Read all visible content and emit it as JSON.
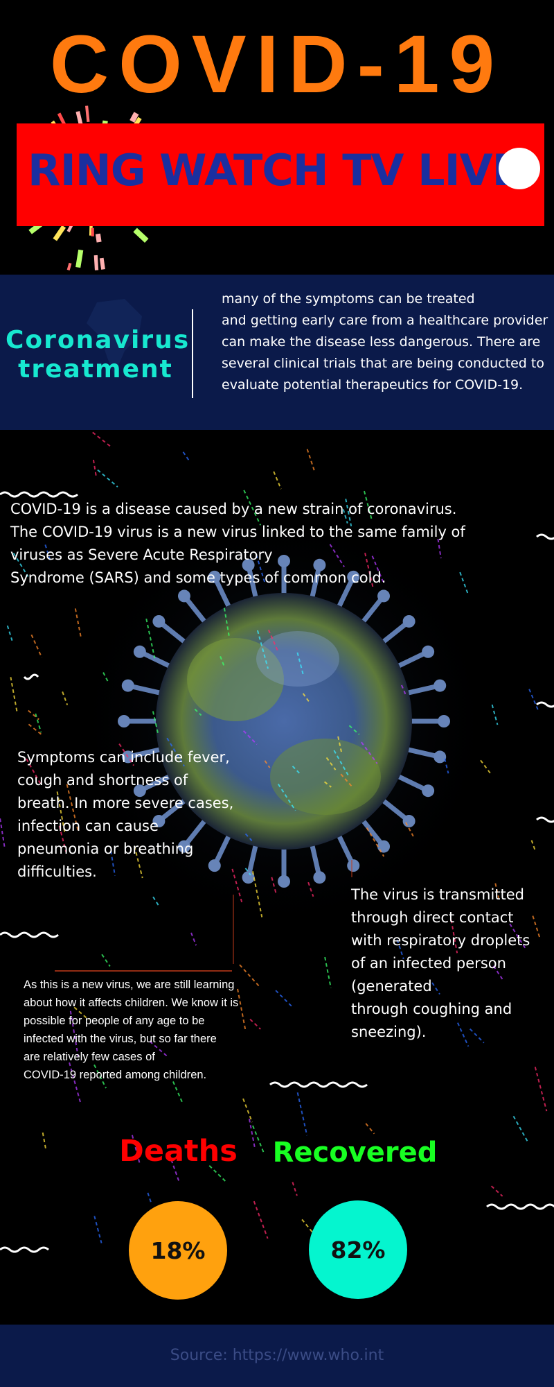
{
  "header": {
    "title": "COVID-19",
    "banner_text": "RING WATCH TV LIVE"
  },
  "treatment": {
    "title_line1": "Coronavirus",
    "title_line2": "treatment",
    "lines": [
      "many of the symptoms can be treated",
      "and getting early care from a healthcare provider",
      "can make the disease less dangerous. There are",
      "several clinical trials that are being conducted to",
      "evaluate potential therapeutics for COVID-19."
    ]
  },
  "intro": {
    "lines": [
      "COVID-19 is a disease caused by a new strain of coronavirus.",
      "The COVID-19 virus is a new virus linked to the same family of",
      "viruses as Severe Acute Respiratory",
      "Syndrome (SARS) and some types of common cold."
    ]
  },
  "symptoms": {
    "lines": [
      "Symptoms can include fever,",
      "cough and shortness of",
      "breath. In more severe cases,",
      "infection can cause",
      "pneumonia or breathing",
      "difficulties."
    ]
  },
  "transmission": {
    "lines": [
      "The virus is transmitted",
      "through direct contact",
      "with respiratory droplets",
      "of an infected person",
      "(generated",
      "through coughing and",
      "sneezing)."
    ]
  },
  "children": {
    "lines": [
      "As this is a new virus, we are still learning",
      "about how it affects children. We know it is",
      "possible for people of any age to be",
      "infected with the virus, but so far there",
      "are relatively few cases of",
      "COVID-19 reported among children."
    ]
  },
  "stats": {
    "deaths_label": "Deaths",
    "deaths_value": "18%",
    "recovered_label": "Recovered",
    "recovered_value": "82%"
  },
  "footer": {
    "source": "Source: https://www.who.int"
  },
  "colors": {
    "title": "#ff7a0f",
    "banner": "#ff0000",
    "banner_text": "#1a2fa0",
    "band": "#0b1a4a",
    "treatment_title": "#17e8d0",
    "deaths": "#ff0000",
    "deaths_circle": "#ffa10e",
    "recovered": "#18ff22",
    "recovered_circle": "#05f5cf"
  }
}
